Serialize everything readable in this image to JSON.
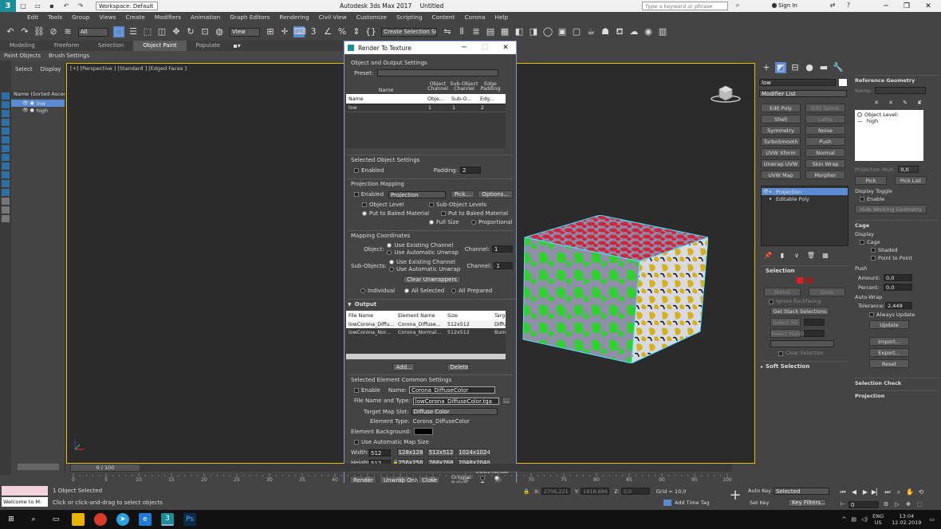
{
  "title_bar": {
    "app_title": "Autodesk 3ds Max 2017",
    "doc_title": "Untitled",
    "workspace_label": "Workspace: Default",
    "search_placeholder": "Type a keyword or phrase",
    "sign_in": "Sign In"
  },
  "menu": [
    "Edit",
    "Tools",
    "Group",
    "Views",
    "Create",
    "Modifiers",
    "Animation",
    "Graph Editors",
    "Rendering",
    "Civil View",
    "Customize",
    "Scripting",
    "Content",
    "Corona",
    "Help"
  ],
  "toolbar": {
    "selection_filter": "All",
    "ref_coord": "View",
    "named_selection": "Create Selection Se"
  },
  "ribbon": {
    "tabs": [
      "Modeling",
      "Freeform",
      "Selection",
      "Object Paint",
      "Populate"
    ],
    "active": "Object Paint",
    "sub": [
      "Paint Objects",
      "Brush Settings"
    ]
  },
  "scene_explorer": {
    "tabs": [
      "Select",
      "Display"
    ],
    "header": "Name (Sorted Ascen",
    "items": [
      "low",
      "high"
    ]
  },
  "viewport": {
    "label": "[+] [Perspective ] [Standard ] [Edged Faces ]"
  },
  "dialog": {
    "title": "Render To Texture",
    "section_object_output": "Object and Output Settings",
    "preset_label": "Preset:",
    "preset_value": "",
    "table_headers": [
      "Name",
      "Object Channel",
      "Sub-Object Channel",
      "Edge Padding"
    ],
    "table_sub": [
      "Name",
      "Obje...",
      "Sub-O...",
      "Edg..."
    ],
    "table_rows": [
      {
        "name": "low",
        "obj": "1",
        "sub": "1",
        "pad": "2"
      }
    ],
    "selected_obj_settings": "Selected Object Settings",
    "enabled": "Enabled",
    "padding_label": "Padding:",
    "padding_value": "2",
    "projection_mapping": "Projection Mapping",
    "projection_value": "Projection",
    "pick": "Pick...",
    "options": "Options...",
    "object_level": "Object Level",
    "sub_object_levels": "Sub-Object Levels",
    "put_baked": "Put to Baked Material",
    "put_baked2": "Put to Baked Material",
    "full_size": "Full Size",
    "proportional": "Proportional",
    "mapping_coords": "Mapping Coordinates",
    "object_label": "Object:",
    "use_existing": "Use Existing Channel",
    "use_auto": "Use Automatic Unwrap",
    "channel_label": "Channel:",
    "channel_value": "1",
    "subobjects_label": "Sub-Objects:",
    "clear_unwrappers": "Clear Unwrappers",
    "individual": "Individual",
    "all_selected": "All Selected",
    "all_prepared": "All Prepared",
    "output": "Output",
    "out_headers": [
      "File Name",
      "Element Name",
      "Size",
      "Targ"
    ],
    "out_rows": [
      {
        "file": "lowCorona_Diffu...",
        "elem": "Corona_Diffuse...",
        "size": "512x512",
        "targ": "Diffu"
      },
      {
        "file": "lowCorona_Nor...",
        "elem": "Corona_Normal...",
        "size": "512x512",
        "targ": "Bum"
      }
    ],
    "add": "Add...",
    "delete": "Delete",
    "sel_elem_common": "Selected Element Common Settings",
    "enable": "Enable",
    "name_label": "Name:",
    "name_value": "Corona_DiffuseColor",
    "file_label": "File Name and Type:",
    "file_value": "lowCorona_DiffuseColor.tga",
    "browse": "...",
    "target_slot_label": "Target Map Slot:",
    "target_slot_value": "Diffuse Color",
    "elem_type_label": "Element Type:",
    "elem_type_value": "Corona_DiffuseColor",
    "elem_bg_label": "Element Background:",
    "use_auto_map": "Use Automatic Map Size",
    "width_label": "Width:",
    "width_value": "512",
    "height_label": "Height:",
    "height_value": "512",
    "size_presets": [
      "128x128",
      "512x512",
      "1024x1024",
      "256x256",
      "768x768",
      "2048x2048"
    ],
    "render": "Render",
    "unwrap_only": "Unwrap Only",
    "close": "Close",
    "views": "Views",
    "render_col": "Render",
    "original": "Original:",
    "baked": "Baked:"
  },
  "command_panel": {
    "object_name": "low",
    "modifier_list": "Modifier List",
    "mod_buttons": [
      "Edit Poly",
      "Edit Spline",
      "Shell",
      "Lathe",
      "Symmetry",
      "Noise",
      "TurboSmooth",
      "Push",
      "UVW Xform",
      "Normal",
      "Unwrap UVW",
      "Skin Wrap",
      "UVW Map",
      "Morpher"
    ],
    "stack": [
      "Projection",
      "Editable Poly"
    ],
    "selection_title": "Selection",
    "shrink": "Shrink",
    "grow": "Grow",
    "ignore_backfacing": "Ignore Backfacing",
    "get_stack_sel": "Get Stack Selections",
    "select_sg": "Select SG",
    "select_matid": "Select MatID",
    "clear_selection": "Clear Selection",
    "soft_selection": "Soft Selection",
    "ref_geometry": "Reference Geometry",
    "name_label": "Name:",
    "object_level": "Object Level:",
    "high": "high",
    "proj_mult": "Projection Mult.",
    "proj_mult_value": "0,0",
    "pick": "Pick",
    "pick_list": "Pick List",
    "display_toggle": "Display Toggle",
    "enable": "Enable",
    "hide_working": "Hide Working Geometry",
    "cage": "Cage",
    "display": "Display",
    "cage_chk": "Cage",
    "shaded": "Shaded",
    "point_to_point": "Point to Point",
    "push": "Push",
    "amount": "Amount:",
    "amount_value": "0,0",
    "percent": "Percent:",
    "percent_value": "0,0",
    "auto_wrap": "Auto-Wrap",
    "tolerance": "Tolerance:",
    "tolerance_value": "2,449",
    "always_update": "Always Update",
    "update": "Update",
    "import": "Import...",
    "export": "Export...",
    "reset": "Reset",
    "selection_check": "Selection Check",
    "projection": "Projection"
  },
  "status": {
    "frame": "0 / 100",
    "ticks": [
      "0",
      "5",
      "10",
      "15",
      "20",
      "25",
      "30",
      "35",
      "40",
      "45",
      "50",
      "55",
      "60",
      "65",
      "70",
      "75",
      "80",
      "85",
      "90",
      "95",
      "100"
    ],
    "objects_selected": "1 Object Selected",
    "hint": "Click or click-and-drag to select objects",
    "welcome": "Welcome to M:",
    "x_label": "X:",
    "x_value": "2706,221",
    "y_label": "Y:",
    "y_value": "1918,686",
    "z_label": "Z:",
    "z_value": "0,0",
    "grid": "Grid = 10,0",
    "add_time_tag": "Add Time Tag",
    "auto_key": "Auto Key",
    "set_key": "Set Key",
    "selected": "Selected",
    "key_filters": "Key Filters...",
    "frame_value": "0"
  },
  "taskbar": {
    "lang1": "ENG",
    "lang2": "US",
    "time": "13:04",
    "date": "12.02.2019"
  },
  "colors": {
    "accent": "#5b8bd0",
    "viewport_border": "#e5c000",
    "cube_red": "#d0253a",
    "cube_green": "#2fd02f",
    "cube_yellow": "#d5b01a"
  }
}
